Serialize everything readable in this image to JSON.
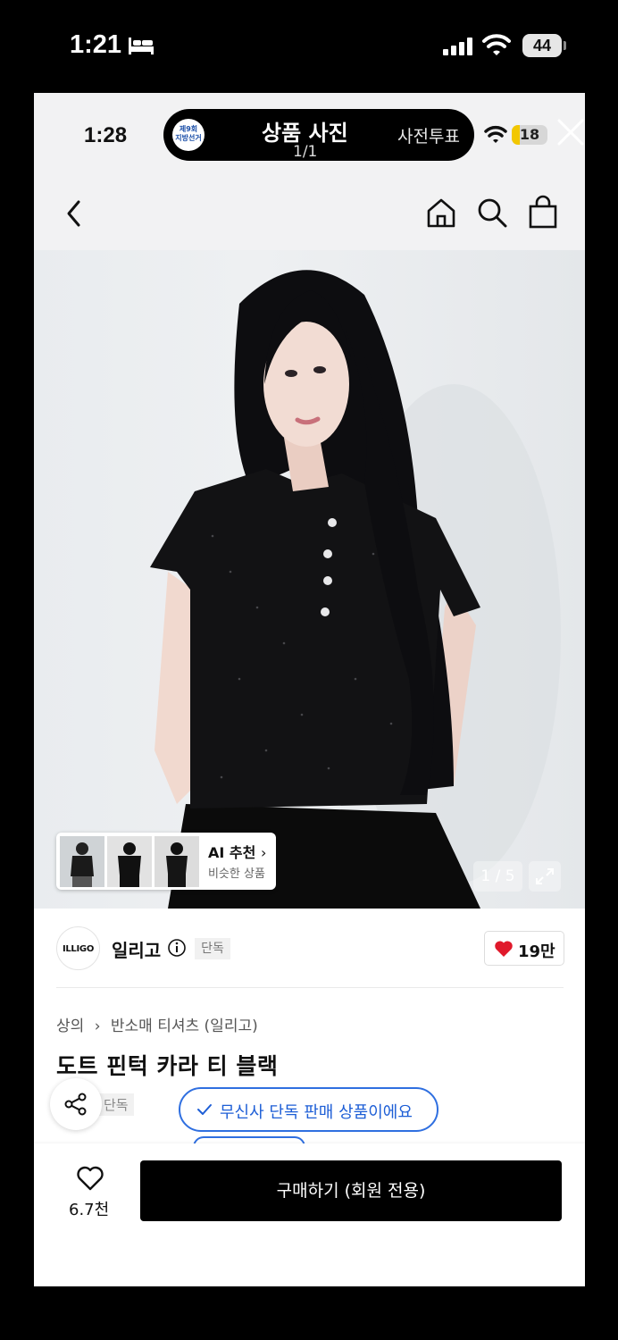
{
  "outer_status": {
    "time": "1:21",
    "battery": "44"
  },
  "inner_status": {
    "time": "1:28",
    "battery": "18"
  },
  "viewer_pill": {
    "title": "상품 사진",
    "page": "1/1",
    "vote_label": "사전투표",
    "logo_text_top": "제9회",
    "logo_text_bottom": "지방선거"
  },
  "photo": {
    "ai_recommend_title": "AI 추천",
    "ai_recommend_subtitle": "비슷한 상품",
    "page_indicator": "1 / 5"
  },
  "brand": {
    "logo_text": "ILLIGO",
    "name": "일리고",
    "badge": "단독",
    "like_count": "19만"
  },
  "breadcrumb": {
    "category": "상의",
    "subcategory": "반소매 티셔츠 (일리고)"
  },
  "product": {
    "title": "도트 핀턱 카라 티 블랙",
    "exclusive_badge": "단독",
    "exclusive_notice": "무신사 단독 판매 상품이에요"
  },
  "bottom_bar": {
    "favorite_count": "6.7천",
    "buy_label": "구매하기 (회원 전용)"
  },
  "colors": {
    "accent_blue": "#2f6fe0",
    "heart_red": "#e0192b",
    "buy_button": "#000000"
  }
}
